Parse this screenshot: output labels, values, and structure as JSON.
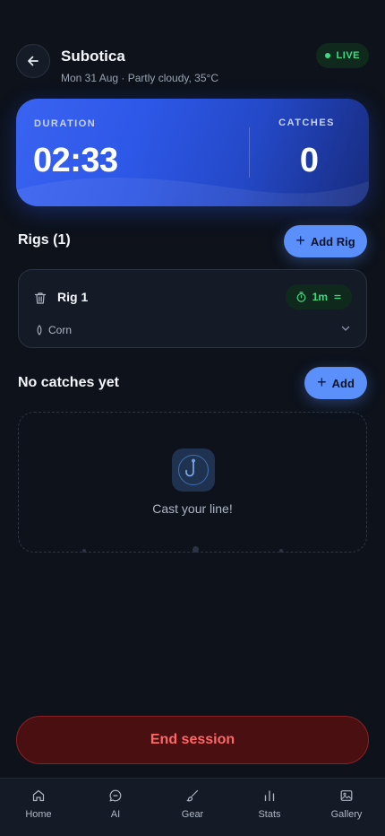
{
  "header": {
    "title": "Subotica",
    "subtitle": "Mon 31 Aug · Partly cloudy, 35°C",
    "live_label": "LIVE"
  },
  "stats": {
    "duration_label": "DURATION",
    "duration_value": "02:33",
    "catches_label": "CATCHES",
    "catches_value": "0"
  },
  "rigs": {
    "title": "Rigs (1)",
    "add_label": "Add Rig",
    "items": [
      {
        "name": "Rig 1",
        "timer": "1m",
        "bait": "Corn"
      }
    ]
  },
  "catches": {
    "title": "No catches yet",
    "add_label": "Add",
    "empty_text": "Cast your line!"
  },
  "end_session_label": "End session",
  "nav": [
    {
      "label": "Home",
      "icon": "home-icon"
    },
    {
      "label": "AI",
      "icon": "chat-icon"
    },
    {
      "label": "Gear",
      "icon": "brush-icon"
    },
    {
      "label": "Stats",
      "icon": "bar-chart-icon"
    },
    {
      "label": "Gallery",
      "icon": "image-icon"
    }
  ],
  "colors": {
    "accent": "#5b8ff9",
    "live_green": "#3ddc84",
    "danger": "#ff6666",
    "background": "#0d121b"
  }
}
